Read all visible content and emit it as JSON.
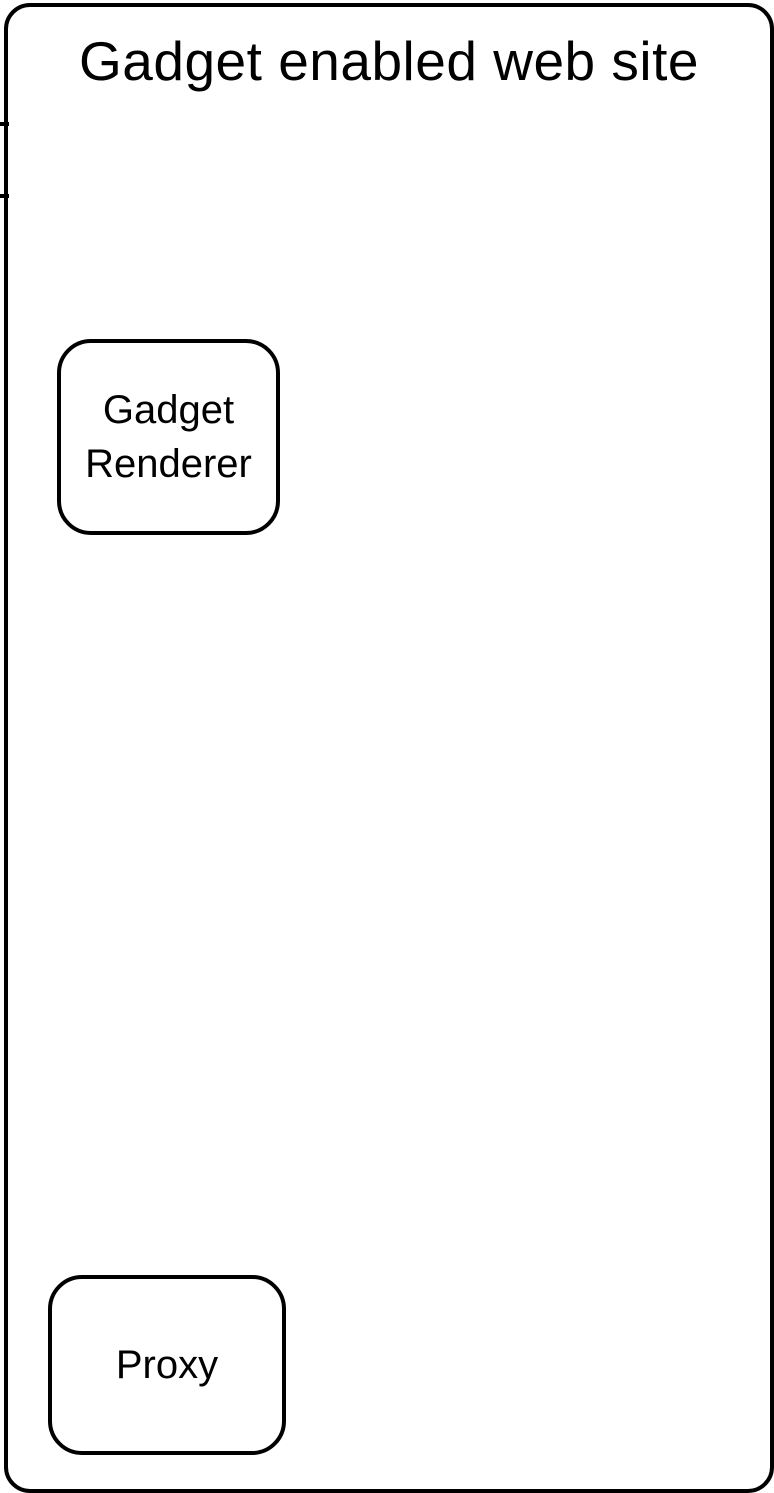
{
  "diagram": {
    "container": {
      "title": "Gadget enabled web site"
    },
    "nodes": [
      {
        "id": "gadget-renderer",
        "lines": [
          "Gadget",
          "Renderer"
        ]
      },
      {
        "id": "proxy",
        "lines": [
          "Proxy"
        ]
      }
    ],
    "colors": {
      "stroke": "#000000",
      "background": "#ffffff"
    }
  }
}
